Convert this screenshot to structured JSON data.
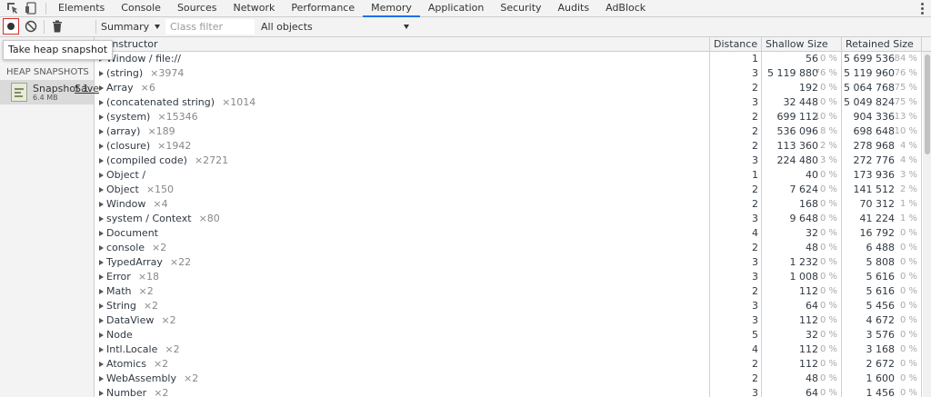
{
  "tabs": [
    "Elements",
    "Console",
    "Sources",
    "Network",
    "Performance",
    "Memory",
    "Application",
    "Security",
    "Audits",
    "AdBlock"
  ],
  "active_tab": "Memory",
  "toolbar": {
    "view_select": "Summary",
    "class_filter_placeholder": "Class filter",
    "objects_select": "All objects"
  },
  "tooltip": "Take heap snapshot",
  "sidebar": {
    "header": "HEAP SNAPSHOTS",
    "snapshot": {
      "title": "Snapshot 1",
      "save": "Save",
      "size": "6.4 MB"
    }
  },
  "grid": {
    "headers": {
      "constructor": "Constructor",
      "distance": "Distance",
      "shallow": "Shallow Size",
      "retained": "Retained Size"
    },
    "rows": [
      {
        "name": "Window / file://",
        "count": "",
        "distance": "1",
        "shallow": "56",
        "shallow_pct": "0 %",
        "retained": "5 699 536",
        "retained_pct": "84 %"
      },
      {
        "name": "(string)",
        "count": "×3974",
        "distance": "3",
        "shallow": "5 119 880",
        "shallow_pct": "76 %",
        "retained": "5 119 960",
        "retained_pct": "76 %"
      },
      {
        "name": "Array",
        "count": "×6",
        "distance": "2",
        "shallow": "192",
        "shallow_pct": "0 %",
        "retained": "5 064 768",
        "retained_pct": "75 %"
      },
      {
        "name": "(concatenated string)",
        "count": "×1014",
        "distance": "3",
        "shallow": "32 448",
        "shallow_pct": "0 %",
        "retained": "5 049 824",
        "retained_pct": "75 %"
      },
      {
        "name": "(system)",
        "count": "×15346",
        "distance": "2",
        "shallow": "699 112",
        "shallow_pct": "10 %",
        "retained": "904 336",
        "retained_pct": "13 %"
      },
      {
        "name": "(array)",
        "count": "×189",
        "distance": "2",
        "shallow": "536 096",
        "shallow_pct": "8 %",
        "retained": "698 648",
        "retained_pct": "10 %"
      },
      {
        "name": "(closure)",
        "count": "×1942",
        "distance": "2",
        "shallow": "113 360",
        "shallow_pct": "2 %",
        "retained": "278 968",
        "retained_pct": "4 %"
      },
      {
        "name": "(compiled code)",
        "count": "×2721",
        "distance": "3",
        "shallow": "224 480",
        "shallow_pct": "3 %",
        "retained": "272 776",
        "retained_pct": "4 %"
      },
      {
        "name": "Object /",
        "count": "",
        "distance": "1",
        "shallow": "40",
        "shallow_pct": "0 %",
        "retained": "173 936",
        "retained_pct": "3 %"
      },
      {
        "name": "Object",
        "count": "×150",
        "distance": "2",
        "shallow": "7 624",
        "shallow_pct": "0 %",
        "retained": "141 512",
        "retained_pct": "2 %"
      },
      {
        "name": "Window",
        "count": "×4",
        "distance": "2",
        "shallow": "168",
        "shallow_pct": "0 %",
        "retained": "70 312",
        "retained_pct": "1 %"
      },
      {
        "name": "system / Context",
        "count": "×80",
        "distance": "3",
        "shallow": "9 648",
        "shallow_pct": "0 %",
        "retained": "41 224",
        "retained_pct": "1 %"
      },
      {
        "name": "Document",
        "count": "",
        "distance": "4",
        "shallow": "32",
        "shallow_pct": "0 %",
        "retained": "16 792",
        "retained_pct": "0 %"
      },
      {
        "name": "console",
        "count": "×2",
        "distance": "2",
        "shallow": "48",
        "shallow_pct": "0 %",
        "retained": "6 488",
        "retained_pct": "0 %"
      },
      {
        "name": "TypedArray",
        "count": "×22",
        "distance": "3",
        "shallow": "1 232",
        "shallow_pct": "0 %",
        "retained": "5 808",
        "retained_pct": "0 %"
      },
      {
        "name": "Error",
        "count": "×18",
        "distance": "3",
        "shallow": "1 008",
        "shallow_pct": "0 %",
        "retained": "5 616",
        "retained_pct": "0 %"
      },
      {
        "name": "Math",
        "count": "×2",
        "distance": "2",
        "shallow": "112",
        "shallow_pct": "0 %",
        "retained": "5 616",
        "retained_pct": "0 %"
      },
      {
        "name": "String",
        "count": "×2",
        "distance": "3",
        "shallow": "64",
        "shallow_pct": "0 %",
        "retained": "5 456",
        "retained_pct": "0 %"
      },
      {
        "name": "DataView",
        "count": "×2",
        "distance": "3",
        "shallow": "112",
        "shallow_pct": "0 %",
        "retained": "4 672",
        "retained_pct": "0 %"
      },
      {
        "name": "Node",
        "count": "",
        "distance": "5",
        "shallow": "32",
        "shallow_pct": "0 %",
        "retained": "3 576",
        "retained_pct": "0 %"
      },
      {
        "name": "Intl.Locale",
        "count": "×2",
        "distance": "4",
        "shallow": "112",
        "shallow_pct": "0 %",
        "retained": "3 168",
        "retained_pct": "0 %"
      },
      {
        "name": "Atomics",
        "count": "×2",
        "distance": "2",
        "shallow": "112",
        "shallow_pct": "0 %",
        "retained": "2 672",
        "retained_pct": "0 %"
      },
      {
        "name": "WebAssembly",
        "count": "×2",
        "distance": "2",
        "shallow": "48",
        "shallow_pct": "0 %",
        "retained": "1 600",
        "retained_pct": "0 %"
      },
      {
        "name": "Number",
        "count": "×2",
        "distance": "3",
        "shallow": "64",
        "shallow_pct": "0 %",
        "retained": "1 456",
        "retained_pct": "0 %"
      }
    ]
  }
}
